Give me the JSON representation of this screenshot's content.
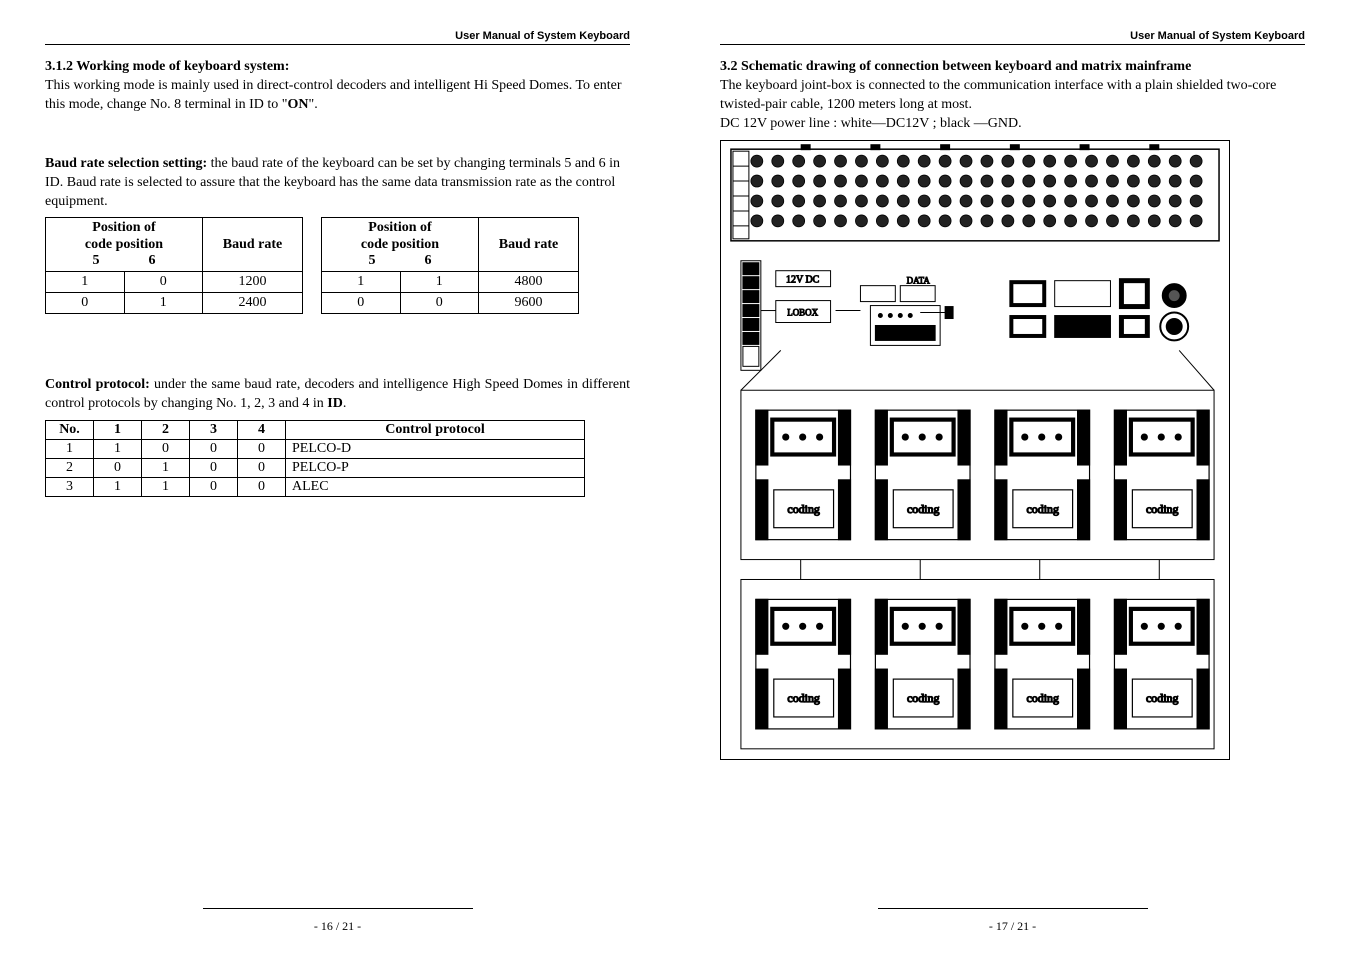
{
  "header": "User Manual of System Keyboard",
  "left": {
    "s1_title": "3.1.2 Working mode of keyboard system:",
    "s1_p1": "  This working mode is mainly used in direct-control decoders and intelligent Hi Speed Domes. To enter this mode, change No. 8 terminal in ID to \"",
    "s1_on": "ON",
    "s1_p1_end": "\".",
    "baud_intro_b": "Baud rate selection setting:",
    "baud_intro": " the baud rate of the keyboard can be set by changing terminals 5 and 6 in ID. Baud rate is selected to assure that the keyboard has the same data transmission rate as the control equipment.",
    "baud_head_pos_l1": "Position of",
    "baud_head_pos_l2": "code position",
    "baud_head_5": "5",
    "baud_head_6": "6",
    "baud_head_rate": "Baud rate",
    "baud_tableA": [
      [
        "1",
        "0",
        "1200"
      ],
      [
        "0",
        "1",
        "2400"
      ]
    ],
    "baud_tableB": [
      [
        "1",
        "1",
        "4800"
      ],
      [
        "0",
        "0",
        "9600"
      ]
    ],
    "proto_intro_b": "Control protocol:",
    "proto_intro": " under the same baud rate, decoders and intelligence High Speed Domes in different control protocols by changing No. 1, 2, 3 and 4 in ",
    "proto_id": "ID",
    "proto_head": [
      "No.",
      "1",
      "2",
      "3",
      "4",
      "Control protocol"
    ],
    "proto_rows": [
      [
        "1",
        "1",
        "0",
        "0",
        "0",
        "PELCO-D"
      ],
      [
        "2",
        "0",
        "1",
        "0",
        "0",
        "PELCO-P"
      ],
      [
        "3",
        "1",
        "1",
        "0",
        "0",
        "ALEC"
      ]
    ],
    "footer": "- 16 / 21 -"
  },
  "right": {
    "s1_title": "3.2 Schematic drawing of connection between keyboard and matrix mainframe",
    "p1": "The keyboard joint-box is connected to the communication interface with a plain shielded two-core twisted-pair cable, 1200 meters long at most.",
    "p2": "DC 12V power line :  white—DC12V ;  black —GND.",
    "footer": "- 17 / 21 -",
    "schematic": {
      "labels": {
        "dc": "12V DC",
        "data": "DATA",
        "coding": "coding",
        "box": "LOBOX"
      }
    }
  }
}
